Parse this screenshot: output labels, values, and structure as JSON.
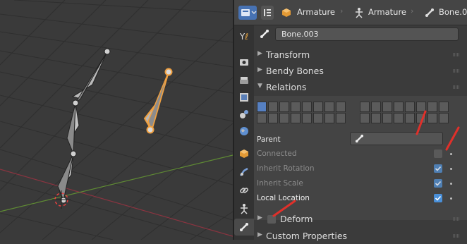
{
  "header": {
    "breadcrumb": [
      {
        "label": "Armature",
        "icon": "armature-object-icon"
      },
      {
        "label": "Armature",
        "icon": "armature-data-icon"
      },
      {
        "label": "Bone.0",
        "icon": "bone-icon"
      }
    ]
  },
  "properties": {
    "bone_name": "Bone.003",
    "panels": {
      "transform": "Transform",
      "bendy_bones": "Bendy Bones",
      "relations": "Relations",
      "deform": "Deform",
      "custom_properties": "Custom Properties"
    },
    "relations": {
      "parent_label": "Parent",
      "parent_value": "",
      "connected_label": "Connected",
      "connected": false,
      "inherit_rotation_label": "Inherit Rotation",
      "inherit_rotation": true,
      "inherit_scale_label": "Inherit Scale",
      "inherit_scale": true,
      "local_location_label": "Local Location",
      "local_location": true
    },
    "deform_enabled": false
  },
  "tabs": [
    "tool-icon",
    "render-icon",
    "output-icon",
    "view-layer-icon",
    "scene-icon",
    "world-icon",
    "object-icon",
    "modifier-icon",
    "constraint-icon",
    "armature-data-icon",
    "bone-icon"
  ],
  "colors": {
    "accent": "#4772b3",
    "checkbox_on": "#4a78b8",
    "selected_bone": "#f0a040",
    "annotation": "#e0302a",
    "grid": "#2e2e2e"
  }
}
